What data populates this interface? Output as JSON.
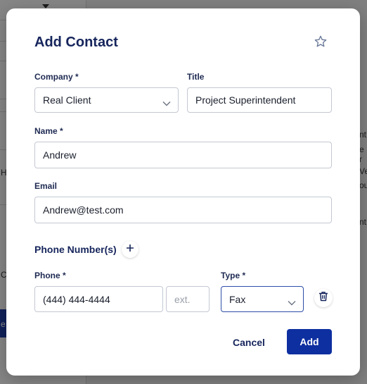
{
  "modal": {
    "title": "Add Contact",
    "icons": {
      "favorite": "star-outline-icon",
      "add_phone": "plus-icon",
      "delete_phone": "trash-icon",
      "select": "chevron-down-icon"
    },
    "fields": {
      "company": {
        "label": "Company *",
        "value": "Real Client"
      },
      "title": {
        "label": "Title",
        "value": "Project Superintendent"
      },
      "name": {
        "label": "Name *",
        "value": "Andrew"
      },
      "email": {
        "label": "Email",
        "value": "Andrew@test.com"
      }
    },
    "phone_section": {
      "title": "Phone Number(s)",
      "phone_label": "Phone *",
      "type_label": "Type *",
      "phones": [
        {
          "number": "(444) 444-4444",
          "ext_placeholder": "ext.",
          "type": "Fax"
        }
      ]
    },
    "actions": {
      "cancel": "Cancel",
      "add": "Add"
    }
  },
  "background": {
    "fragments": [
      "nt",
      "e r",
      "Ve",
      "ou",
      "nt",
      "Hi",
      "C",
      "e"
    ]
  },
  "colors": {
    "primary": "#0d2fa0",
    "title": "#16255c",
    "focus_border": "#2d4ea8"
  }
}
